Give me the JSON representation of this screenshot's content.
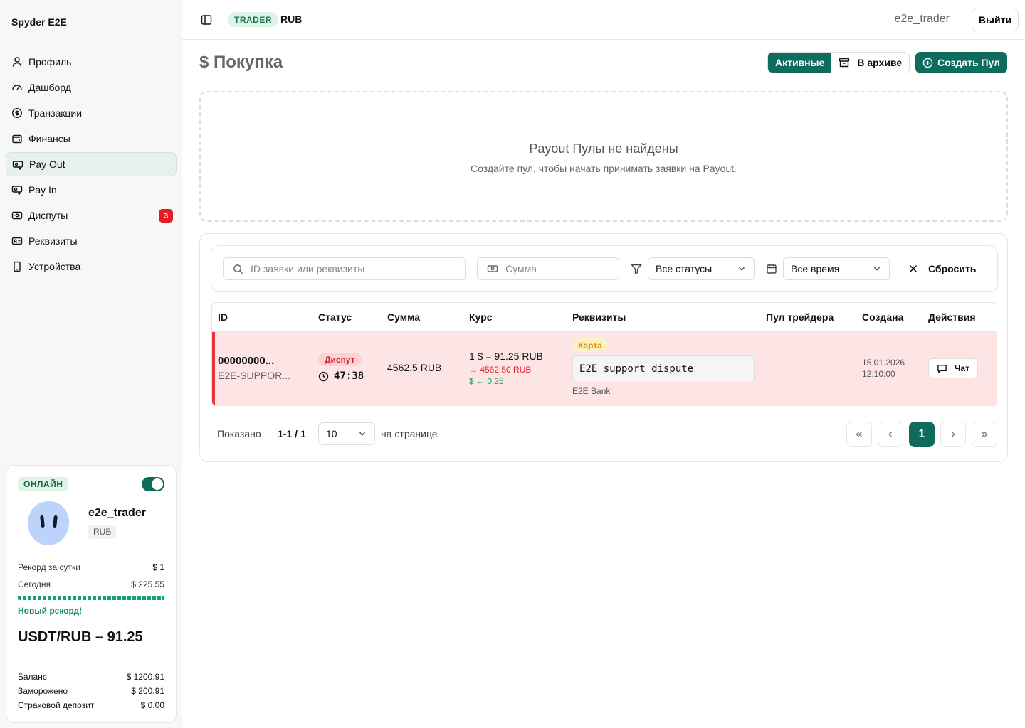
{
  "app": {
    "brand": "Spyder E2E"
  },
  "sidebar": {
    "items": [
      {
        "label": "Профиль",
        "icon": "user-icon"
      },
      {
        "label": "Дашборд",
        "icon": "gauge-icon"
      },
      {
        "label": "Транзакции",
        "icon": "dollar-circle-icon"
      },
      {
        "label": "Финансы",
        "icon": "wallet-icon"
      },
      {
        "label": "Pay Out",
        "icon": "payout-icon",
        "active": true
      },
      {
        "label": "Pay In",
        "icon": "payin-icon"
      },
      {
        "label": "Диспуты",
        "icon": "dispute-icon",
        "badge": "3"
      },
      {
        "label": "Реквизиты",
        "icon": "id-card-icon"
      },
      {
        "label": "Устройства",
        "icon": "phone-icon"
      }
    ]
  },
  "profile": {
    "status": "ОНЛАЙН",
    "username": "e2e_trader",
    "currency": "RUB",
    "record_label": "Рекорд за сутки",
    "record_value": "$ 1",
    "today_label": "Сегодня",
    "today_value": "$ 225.55",
    "new_record": "Новый рекорд!",
    "rate": "USDT/RUB – 91.25",
    "balance_label": "Баланс",
    "balance_value": "$ 1200.91",
    "frozen_label": "Заморожено",
    "frozen_value": "$ 200.91",
    "deposit_label": "Страховой депозит",
    "deposit_value": "$ 0.00"
  },
  "header": {
    "role_tag": "TRADER",
    "currency": "RUB",
    "user": "e2e_trader",
    "logout_label": "Выйти"
  },
  "page": {
    "title": "$ Покупка",
    "tab_active": "Активные",
    "tab_archive": "В архиве",
    "create_label": "Создать Пул"
  },
  "empty": {
    "title": "Payout Пулы не найдены",
    "subtitle": "Создайте пул, чтобы начать принимать заявки на Payout."
  },
  "filters": {
    "search_placeholder": "ID заявки или реквизиты",
    "amount_placeholder": "Сумма",
    "status_value": "Все статусы",
    "time_value": "Все время",
    "reset_label": "Сбросить"
  },
  "table": {
    "columns": [
      "ID",
      "Статус",
      "Сумма",
      "Курс",
      "Реквизиты",
      "Пул трейдера",
      "Создана",
      "Действия"
    ],
    "rows": [
      {
        "id": "00000000...",
        "sub_id": "E2E-SUPPOR...",
        "status": "Диспут",
        "timer": "47:38",
        "amount": "4562.5 RUB",
        "rate": "1 $ = 91.25 RUB",
        "rate_out": "→ 4562.50 RUB",
        "rate_in": "$ ← 0.25",
        "req_type": "Карта",
        "req_value": "E2E support dispute",
        "req_bank": "E2E Bank",
        "created_date": "15.01.2026",
        "created_time": "12:10:00",
        "action_label": "Чат"
      }
    ]
  },
  "pager": {
    "shown_label": "Показано",
    "shown_value": "1-1 / 1",
    "per_page": "10",
    "per_page_label": "на странице",
    "current_page": "1"
  },
  "colors": {
    "primary": "#0f6b5b",
    "dispute": "#e5353d",
    "dispute_bg": "#fee5e5",
    "badge": "#e11d24"
  }
}
